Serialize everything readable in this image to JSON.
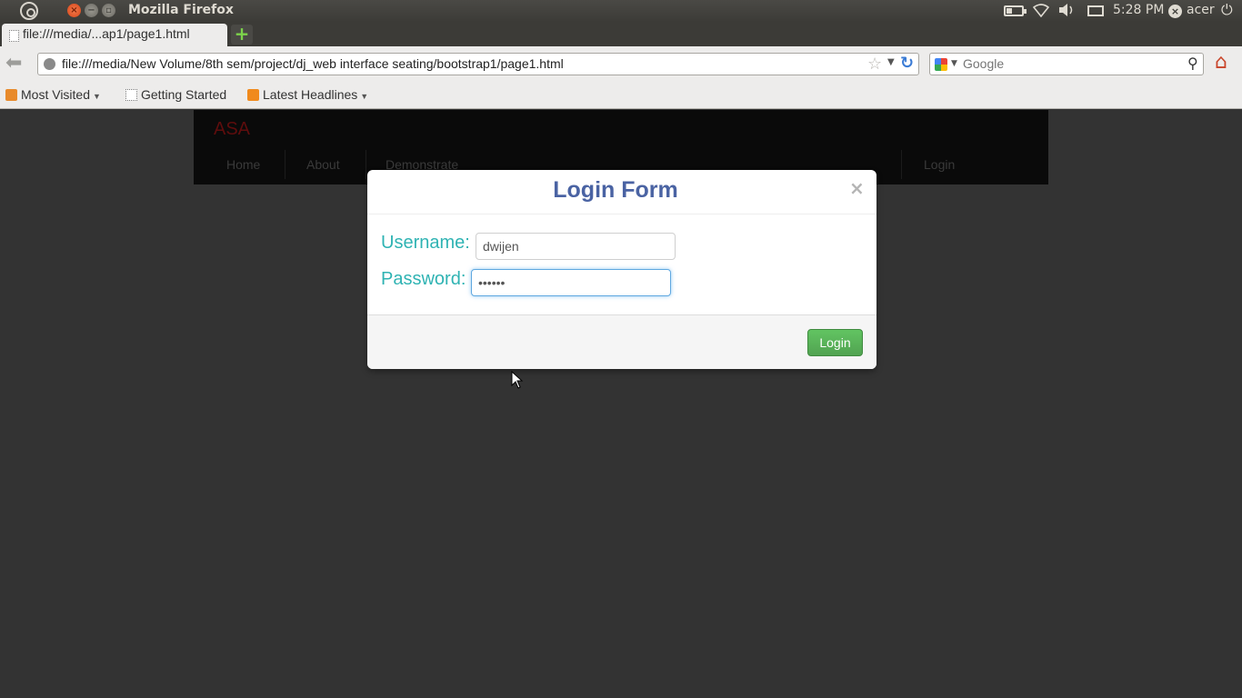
{
  "system_panel": {
    "window_title": "Mozilla Firefox",
    "close_glyph": "×",
    "minimize_glyph": "−",
    "maximize_glyph": "▫",
    "clock": "5:28 PM",
    "user": "acer",
    "icons": [
      "ubuntu-logo-icon",
      "battery-icon",
      "wifi-icon",
      "volume-icon",
      "mail-icon",
      "power-icon"
    ]
  },
  "tabs": [
    {
      "title": "file:///media/...ap1/page1.html",
      "active": true
    }
  ],
  "new_tab_glyph": "+",
  "navigation": {
    "url": "file:///media/New Volume/8th sem/project/dj_web interface seating/bootstrap1/page1.html",
    "search_placeholder": "Google"
  },
  "bookmarks": [
    {
      "label": "Most Visited",
      "has_dropdown": true
    },
    {
      "label": "Getting Started",
      "has_dropdown": false
    },
    {
      "label": "Latest Headlines",
      "has_dropdown": true
    }
  ],
  "site_navbar": {
    "brand": "ASA",
    "links": [
      "Home",
      "About",
      "Demonstrate"
    ],
    "login_link": "Login"
  },
  "modal": {
    "title": "Login Form",
    "close_glyph": "×",
    "username_label": "Username:",
    "username_value": "dwijen",
    "password_label": "Password:",
    "password_value": "••••••",
    "submit_label": "Login",
    "colors": {
      "title": "#4a63a3",
      "labels": "#2fb3b3",
      "button": "#51a351"
    }
  }
}
